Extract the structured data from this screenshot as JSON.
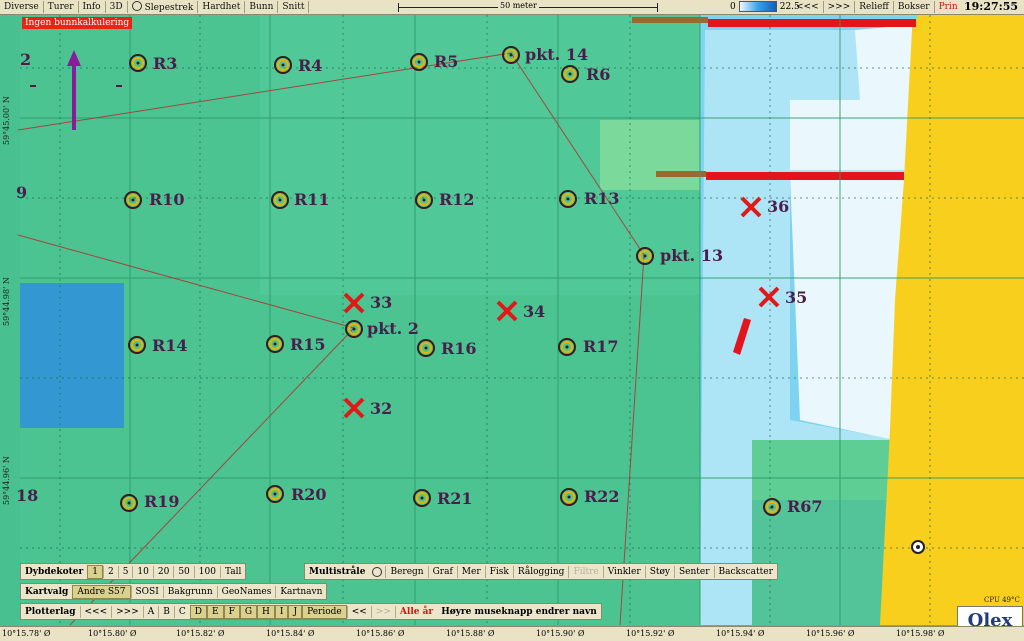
{
  "toolbar": {
    "items": [
      "Diverse",
      "Turer",
      "Info",
      "3D",
      "Slepestrek",
      "Hardhet",
      "Bunn",
      "Snitt"
    ],
    "scale_label": "50 meter",
    "depth_min": "0",
    "depth_max": "22.5",
    "right_items": [
      "<<<",
      ">>>",
      "Relieff",
      "Bokser",
      "Print"
    ],
    "clock": "19:27:55"
  },
  "map": {
    "warning": "Ingen bunnkalkulering",
    "left_edge_labels": [
      "2",
      "9",
      "18"
    ],
    "lat_labels": [
      "59°45.00' N",
      "59°44.98' N",
      "59°44.96' N"
    ],
    "markers": [
      {
        "name": "R3"
      },
      {
        "name": "R4"
      },
      {
        "name": "R5"
      },
      {
        "name": "pkt. 14"
      },
      {
        "name": "R6"
      },
      {
        "name": "R10"
      },
      {
        "name": "R11"
      },
      {
        "name": "R12"
      },
      {
        "name": "R13"
      },
      {
        "name": "pkt. 13"
      },
      {
        "name": "pkt. 2"
      },
      {
        "name": "R14"
      },
      {
        "name": "R15"
      },
      {
        "name": "R16"
      },
      {
        "name": "R17"
      },
      {
        "name": "R19"
      },
      {
        "name": "R20"
      },
      {
        "name": "R21"
      },
      {
        "name": "R22"
      },
      {
        "name": "R67"
      }
    ],
    "crosses": [
      {
        "name": "36"
      },
      {
        "name": "35"
      },
      {
        "name": "33"
      },
      {
        "name": "34"
      },
      {
        "name": "32"
      }
    ],
    "lon_labels": [
      "10°15.78' Ø",
      "10°15.80' Ø",
      "10°15.82' Ø",
      "10°15.84' Ø",
      "10°15.86' Ø",
      "10°15.88' Ø",
      "10°15.90' Ø",
      "10°15.92' Ø",
      "10°15.94' Ø",
      "10°15.96' Ø",
      "10°15.98' Ø"
    ]
  },
  "panels": {
    "dybdekoter": {
      "label": "Dybdekoter",
      "items": [
        "1",
        "2",
        "5",
        "10",
        "20",
        "50",
        "100",
        "Tall"
      ]
    },
    "multistraale": {
      "label": "Multistråle",
      "items": [
        "Beregn",
        "Graf",
        "Mer",
        "Fisk",
        "Rålogging",
        "Filtre",
        "Vinkler",
        "Støy",
        "Senter",
        "Backscatter"
      ]
    },
    "kartvalg": {
      "label": "Kartvalg",
      "items": [
        "Andre S57",
        "SOSI",
        "Bakgrunn",
        "GeoNames",
        "Kartnavn"
      ]
    },
    "plotterlag": {
      "label": "Plotterlag",
      "items": [
        "<<<",
        ">>>",
        "A",
        "B",
        "C",
        "D",
        "E",
        "F",
        "G",
        "H",
        "I",
        "J",
        "Periode",
        "<<",
        ">>",
        "Alle år"
      ],
      "hint": "Høyre museknapp endrer navn"
    }
  },
  "status": {
    "cpu": "CPU 49°C",
    "brand": "Olex"
  }
}
